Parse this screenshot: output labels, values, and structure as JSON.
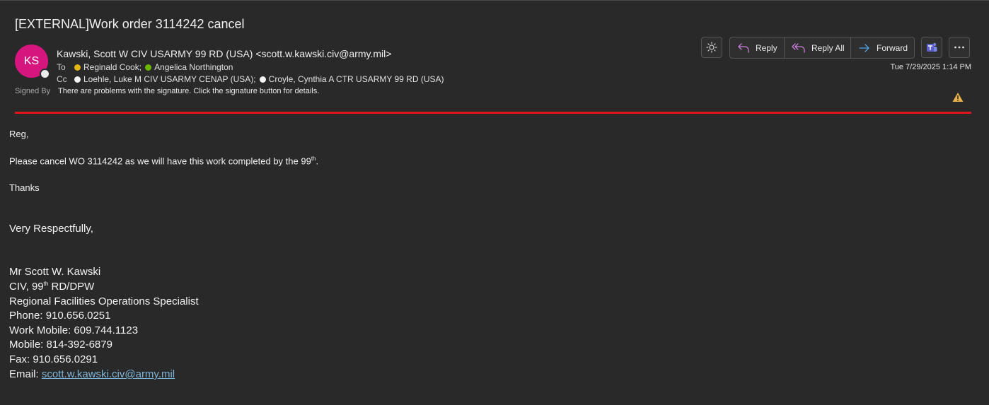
{
  "subject": "[EXTERNAL]Work order 3114242 cancel",
  "sender": {
    "initials": "KS",
    "display": "Kawski, Scott W CIV USARMY 99 RD (USA) <scott.w.kawski.civ@army.mil>",
    "avatar_color": "#d6157e"
  },
  "to": {
    "label": "To",
    "recipients": [
      "Reginald Cook;",
      "Angelica Northington"
    ]
  },
  "cc": {
    "label": "Cc",
    "recipients": [
      "Loehle, Luke M CIV USARMY CENAP (USA);",
      "Croyle, Cynthia A CTR USARMY 99 RD (USA)"
    ]
  },
  "signed": {
    "label": "Signed By",
    "message": "There are problems with the signature. Click the signature button for details."
  },
  "actions": {
    "reply": "Reply",
    "reply_all": "Reply All",
    "forward": "Forward"
  },
  "date": "Tue 7/29/2025 1:14 PM",
  "body": {
    "greeting": "Reg,",
    "line1_pre": "Please cancel WO 3114242 as we will have this work completed by the 99",
    "line1_sup": "th",
    "line1_post": ".",
    "thanks": "Thanks",
    "closing": "Very Respectfully,",
    "sig_name": "Mr Scott W. Kawski",
    "sig_title_pre": "CIV, 99",
    "sig_title_sup": "th",
    "sig_title_post": " RD/DPW",
    "sig_role": "Regional Facilities Operations Specialist",
    "phone": "Phone: 910.656.0251",
    "work_mobile": "Work Mobile: 609.744.1123",
    "mobile": "Mobile: 814-392-6879",
    "fax": "Fax: 910.656.0291",
    "email_label": "Email: ",
    "email": "scott.w.kawski.civ@army.mil"
  },
  "colors": {
    "accent_red": "#e0141c",
    "warning": "#e8b04a",
    "teams": "#5b5fc7",
    "link": "#7fb3d6"
  }
}
